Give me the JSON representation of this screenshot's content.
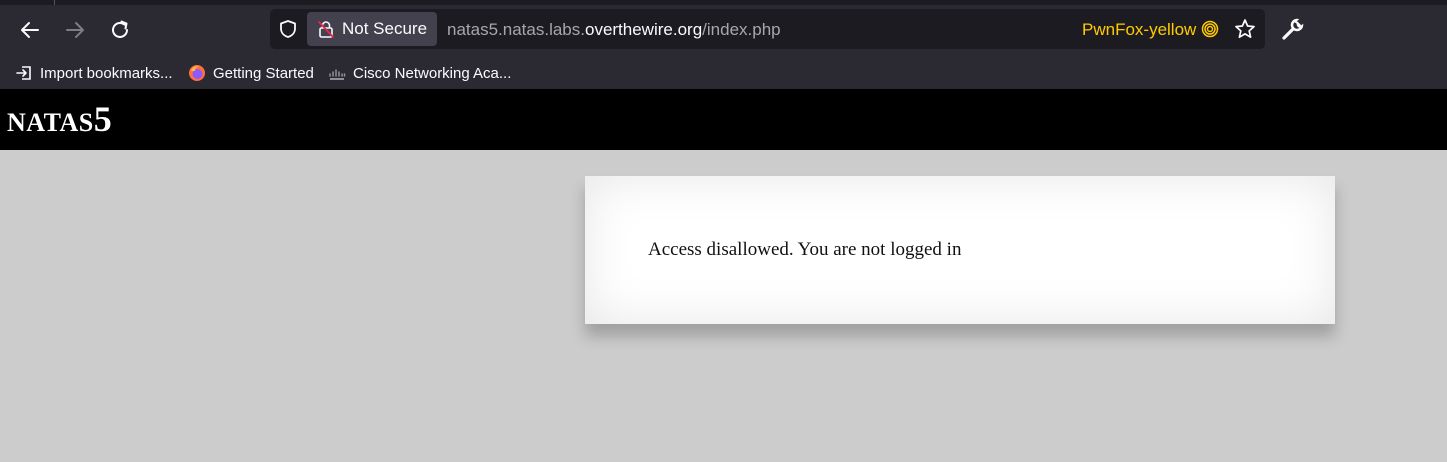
{
  "browser": {
    "security_label": "Not Secure",
    "url": {
      "prefix": "natas5.natas.labs.",
      "domain": "overthewire.org",
      "path": "/index.php"
    },
    "container_label": "PwnFox-yellow",
    "container_color": "#ffcb00"
  },
  "bookmarks": [
    {
      "label": "Import bookmarks...",
      "icon": "import-icon"
    },
    {
      "label": "Getting Started",
      "icon": "firefox-icon"
    },
    {
      "label": "Cisco Networking Aca...",
      "icon": "cisco-icon"
    }
  ],
  "page": {
    "title_prefix": "NATAS",
    "title_number": "5",
    "message": "Access disallowed. You are not logged in"
  }
}
